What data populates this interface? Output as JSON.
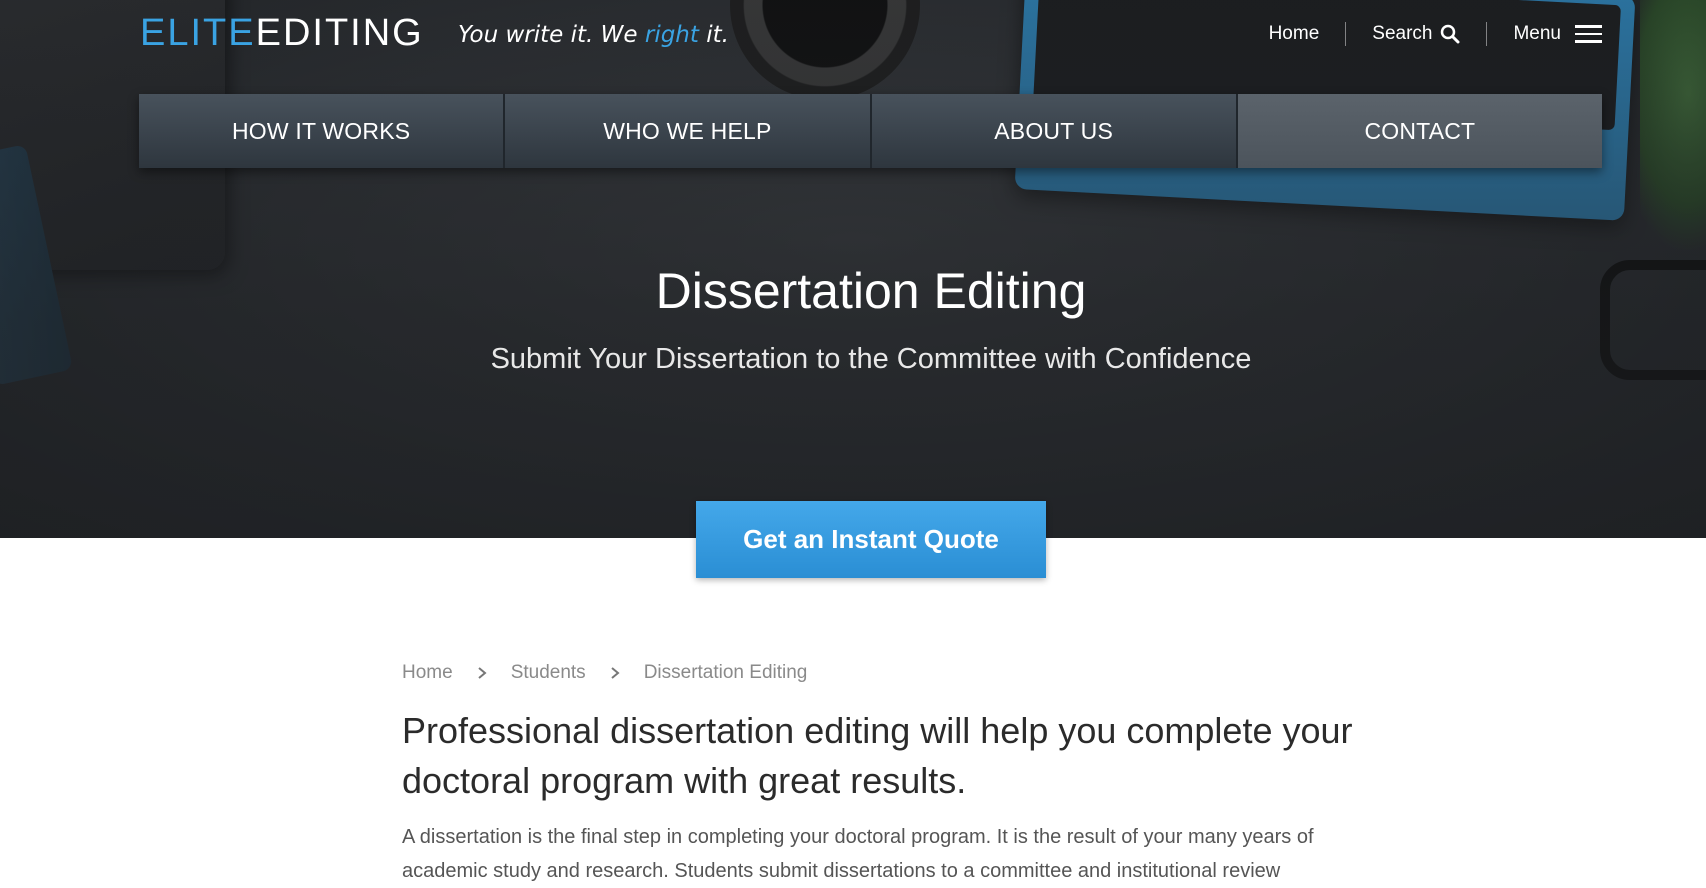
{
  "header": {
    "logo_elite": "ELITE",
    "logo_editing": "EDITING",
    "tagline_pre": "You write it. We ",
    "tagline_accent": "right",
    "tagline_post": " it.",
    "links": {
      "home": "Home",
      "search": "Search",
      "menu": "Menu"
    },
    "icons": [
      "search-icon",
      "menu-icon"
    ]
  },
  "nav": {
    "items": [
      {
        "label": "HOW IT WORKS"
      },
      {
        "label": "WHO WE HELP"
      },
      {
        "label": "ABOUT US"
      },
      {
        "label": "CONTACT"
      }
    ],
    "active": "CONTACT"
  },
  "hero": {
    "title": "Dissertation Editing",
    "subtitle": "Submit Your Dissertation to the Committee with Confidence",
    "cta_label": "Get an Instant Quote"
  },
  "breadcrumb": {
    "items": [
      "Home",
      "Students",
      "Dissertation Editing"
    ]
  },
  "content": {
    "heading": "Professional dissertation editing will help you complete your doctoral program with great results.",
    "paragraph": "A dissertation is the final step in completing your doctoral program. It is the result of your many years of academic study and research. Students submit dissertations to a committee and institutional review"
  },
  "colors": {
    "accent": "#3aa3e3",
    "cta": "#2a8ed4",
    "nav": "#2e363e",
    "nav_active": "#4c545c"
  }
}
